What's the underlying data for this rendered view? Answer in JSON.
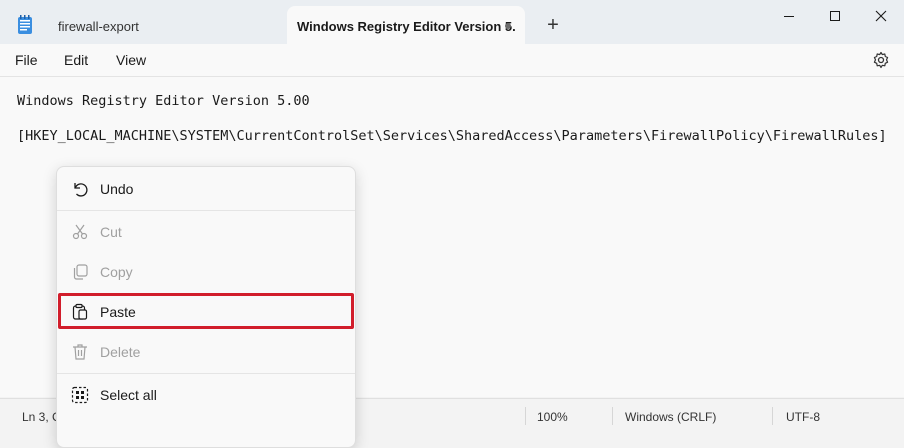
{
  "tabs": [
    {
      "label": "firewall-export",
      "active": false
    },
    {
      "label": "Windows Registry Editor Version 5.",
      "active": true,
      "unsaved": true
    }
  ],
  "icons": {
    "app": "notepad-icon",
    "new_tab": "plus-icon",
    "minimize": "minimize-icon",
    "maximize": "maximize-icon",
    "close": "close-icon",
    "settings": "gear-icon"
  },
  "menu": [
    "File",
    "Edit",
    "View"
  ],
  "editor": {
    "lines": [
      "Windows Registry Editor Version 5.00",
      "[HKEY_LOCAL_MACHINE\\SYSTEM\\CurrentControlSet\\Services\\SharedAccess\\Parameters\\FirewallPolicy\\FirewallRules]"
    ]
  },
  "context_menu": {
    "items": [
      {
        "label": "Undo",
        "icon": "undo-icon",
        "enabled": true
      },
      {
        "label": "Cut",
        "icon": "cut-icon",
        "enabled": false
      },
      {
        "label": "Copy",
        "icon": "copy-icon",
        "enabled": false
      },
      {
        "label": "Paste",
        "icon": "paste-icon",
        "enabled": true,
        "highlighted": true
      },
      {
        "label": "Delete",
        "icon": "delete-icon",
        "enabled": false
      },
      {
        "label": "Select all",
        "icon": "select-all-icon",
        "enabled": true
      }
    ],
    "highlight_color": "#d11d2b"
  },
  "status": {
    "position": "Ln 3, C",
    "zoom": "100%",
    "line_ending": "Windows (CRLF)",
    "encoding": "UTF-8"
  }
}
